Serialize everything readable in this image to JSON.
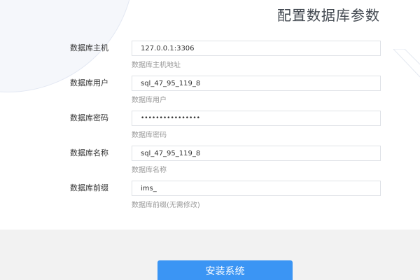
{
  "header": {
    "title": "配置数据库参数"
  },
  "fields": [
    {
      "label": "数据库主机",
      "value": "127.0.0.1:3306",
      "hint": "数据库主机地址",
      "type": "text"
    },
    {
      "label": "数据库用户",
      "value": "sql_47_95_119_8",
      "hint": "数据库用户",
      "type": "text"
    },
    {
      "label": "数据库密码",
      "value": "••••••••••••••••",
      "hint": "数据库密码",
      "type": "password"
    },
    {
      "label": "数据库名称",
      "value": "sql_47_95_119_8",
      "hint": "数据库名称",
      "type": "text"
    },
    {
      "label": "数据库前缀",
      "value": "ims_",
      "hint": "数据库前缀(无需修改)",
      "type": "text"
    }
  ],
  "footer": {
    "install_label": "安装系统"
  },
  "colors": {
    "accent": "#3b95f4",
    "footer_bg": "#f2f2f2",
    "hint_text": "#999999"
  }
}
